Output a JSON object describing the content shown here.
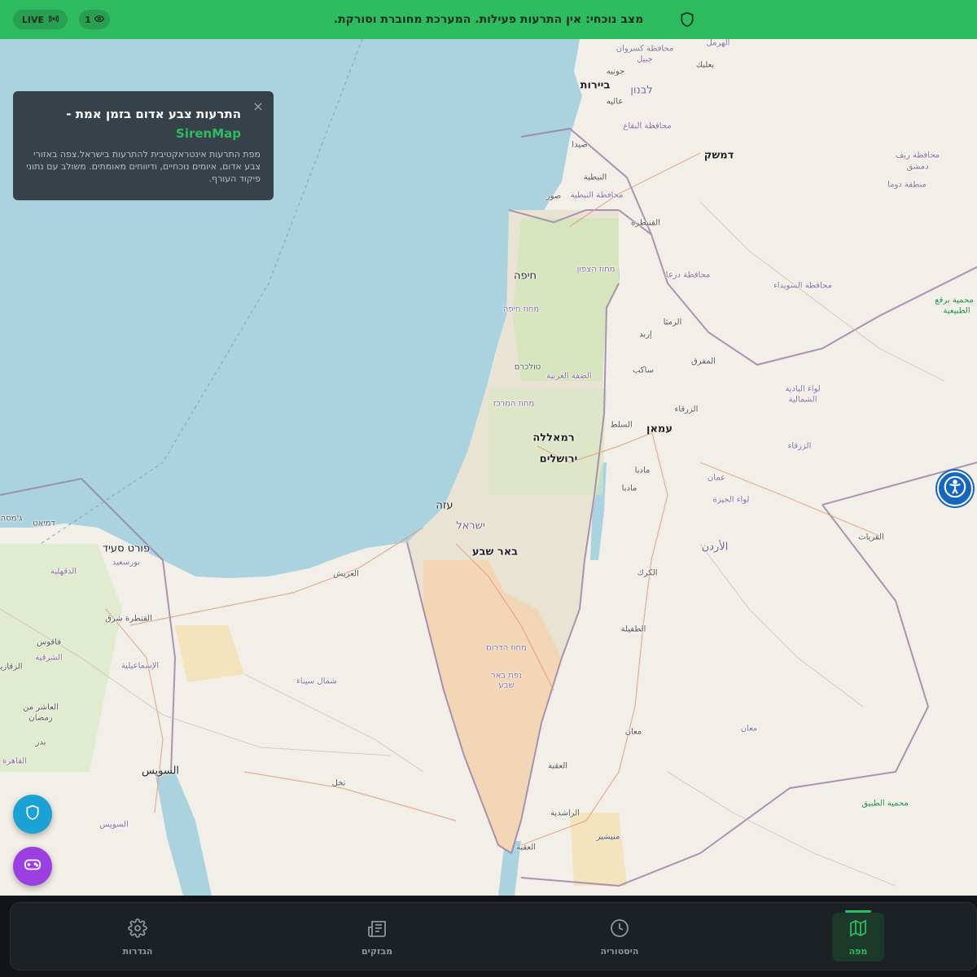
{
  "topbar": {
    "live_label": "LIVE",
    "viewers_count": "1",
    "status_text": "מצב נוכחי: אין התרעות פעילות. המערכת מחוברת וסורקת.",
    "color": "#2fbc61"
  },
  "info_card": {
    "title": "התרעות צבע אדום בזמן אמת -",
    "brand": "SirenMap",
    "description": "מפת התרעות אינטראקטיבית להתרעות בישראל.צפה באזורי צבע אדום, איומים נוכחיים, ודיווחים מאומתים. משולב עם נתוני פיקוד העורף.",
    "close_icon": "close-icon"
  },
  "map": {
    "labels": [
      {
        "text": "الهرمل",
        "cls": "region"
      },
      {
        "text": "محافظة كسروان",
        "cls": "region"
      },
      {
        "text": "جبيل",
        "cls": "region"
      },
      {
        "text": "بعلبك",
        "cls": ""
      },
      {
        "text": "جونيه",
        "cls": ""
      },
      {
        "text": "ביירות",
        "cls": "city"
      },
      {
        "text": "לבנון",
        "cls": "country"
      },
      {
        "text": "عاليه",
        "cls": ""
      },
      {
        "text": "محافظة البقاع",
        "cls": "region"
      },
      {
        "text": "صيدا",
        "cls": ""
      },
      {
        "text": "דמשק",
        "cls": "city"
      },
      {
        "text": "محافظة ريف",
        "cls": "region"
      },
      {
        "text": "دمشق",
        "cls": "region"
      },
      {
        "text": "منطقة دوما",
        "cls": "region"
      },
      {
        "text": "النبطية",
        "cls": ""
      },
      {
        "text": "صور",
        "cls": ""
      },
      {
        "text": "محافظة النبطية",
        "cls": "region"
      },
      {
        "text": "القنيطرة",
        "cls": ""
      },
      {
        "text": "מחוז הצפון",
        "cls": "region"
      },
      {
        "text": "חיפה",
        "cls": "big"
      },
      {
        "text": "محافظة درعا",
        "cls": "region"
      },
      {
        "text": "محافظة السويداء",
        "cls": "region"
      },
      {
        "text": "محمية برقع",
        "cls": "green"
      },
      {
        "text": "الطبيعية",
        "cls": "green"
      },
      {
        "text": "מחוז חיפה",
        "cls": "region"
      },
      {
        "text": "الرمثا",
        "cls": ""
      },
      {
        "text": "إربد",
        "cls": ""
      },
      {
        "text": "المفرق",
        "cls": ""
      },
      {
        "text": "טולכרם",
        "cls": ""
      },
      {
        "text": "الضفة الغربية",
        "cls": "region"
      },
      {
        "text": "ساكب",
        "cls": ""
      },
      {
        "text": "لواء البادية",
        "cls": "region"
      },
      {
        "text": "الشمالية",
        "cls": "region"
      },
      {
        "text": "מחוז המרכז",
        "cls": "region"
      },
      {
        "text": "الزرقاء",
        "cls": ""
      },
      {
        "text": "السلط",
        "cls": ""
      },
      {
        "text": "עמאן",
        "cls": "city"
      },
      {
        "text": "الزرقاء",
        "cls": "region"
      },
      {
        "text": "רמאללה",
        "cls": "city"
      },
      {
        "text": "ירושלים",
        "cls": "city"
      },
      {
        "text": "مادبا",
        "cls": ""
      },
      {
        "text": "عمان",
        "cls": "region"
      },
      {
        "text": "مادبا",
        "cls": ""
      },
      {
        "text": "لواء الجيزة",
        "cls": "region"
      },
      {
        "text": "עזה",
        "cls": "big"
      },
      {
        "text": "ישראל",
        "cls": "country"
      },
      {
        "text": "القريات",
        "cls": ""
      },
      {
        "text": "דמיאט",
        "cls": ""
      },
      {
        "text": "ג'מסה",
        "cls": ""
      },
      {
        "text": "פורט סעיד",
        "cls": "big"
      },
      {
        "text": "بورسعيد",
        "cls": "region"
      },
      {
        "text": "الأردن",
        "cls": "country"
      },
      {
        "text": "באר שבע",
        "cls": "city"
      },
      {
        "text": "الدقهلية",
        "cls": "region"
      },
      {
        "text": "العريش",
        "cls": ""
      },
      {
        "text": "الكرك",
        "cls": ""
      },
      {
        "text": "القنطرة شرق",
        "cls": ""
      },
      {
        "text": "الطفيلة",
        "cls": ""
      },
      {
        "text": "فاقوس",
        "cls": ""
      },
      {
        "text": "מחוז הדרום",
        "cls": "region"
      },
      {
        "text": "الشرقية",
        "cls": "region"
      },
      {
        "text": "الإسماعيلية",
        "cls": "region"
      },
      {
        "text": "الزقازيق",
        "cls": ""
      },
      {
        "text": "נפת באר",
        "cls": "region"
      },
      {
        "text": "שבע",
        "cls": "region"
      },
      {
        "text": "شمال سيناء",
        "cls": "region"
      },
      {
        "text": "العاشر من",
        "cls": ""
      },
      {
        "text": "رمضان",
        "cls": ""
      },
      {
        "text": "معان",
        "cls": ""
      },
      {
        "text": "معان",
        "cls": "region"
      },
      {
        "text": "بدر",
        "cls": ""
      },
      {
        "text": "القاهرة",
        "cls": "region"
      },
      {
        "text": "السويس",
        "cls": "big"
      },
      {
        "text": "العقبة",
        "cls": ""
      },
      {
        "text": "نخل",
        "cls": ""
      },
      {
        "text": "محمية الطبيق",
        "cls": "green"
      },
      {
        "text": "الراشدية",
        "cls": ""
      },
      {
        "text": "منيشير",
        "cls": ""
      },
      {
        "text": "السويس",
        "cls": "region"
      },
      {
        "text": "العقبة",
        "cls": ""
      }
    ]
  },
  "accessibility": {
    "icon": "accessibility-icon"
  },
  "fabs": {
    "shield_icon": "shield-icon",
    "game_icon": "gamepad-icon"
  },
  "nav": {
    "items": [
      {
        "label": "מפה",
        "icon": "map-icon",
        "active": true
      },
      {
        "label": "היסטוריה",
        "icon": "clock-icon",
        "active": false
      },
      {
        "label": "מבזקים",
        "icon": "newspaper-icon",
        "active": false
      },
      {
        "label": "הגדרות",
        "icon": "gear-icon",
        "active": false
      }
    ],
    "accent": "#2fbc61"
  }
}
